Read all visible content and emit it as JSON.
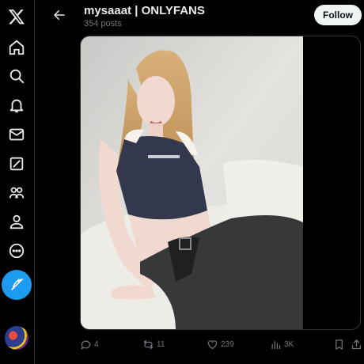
{
  "sidebar": {
    "items": [
      {
        "icon": "x-logo-icon"
      },
      {
        "icon": "home-icon"
      },
      {
        "icon": "search-icon"
      },
      {
        "icon": "notifications-icon"
      },
      {
        "icon": "messages-icon"
      },
      {
        "icon": "grok-icon"
      },
      {
        "icon": "communities-icon"
      },
      {
        "icon": "profile-icon"
      },
      {
        "icon": "more-icon"
      }
    ],
    "compose_icon": "feather-icon",
    "accent": "#1d9bf0"
  },
  "header": {
    "title": "mysaaat | ONLYFANS",
    "subtitle": "354 posts",
    "follow_label": "Follow"
  },
  "actions": {
    "replies": "4",
    "reposts": "11",
    "likes": "239",
    "views": "3K"
  },
  "colors": {
    "background": "#000000",
    "text": "#e7e9ea",
    "muted": "#71767b",
    "border": "#2f3336"
  }
}
